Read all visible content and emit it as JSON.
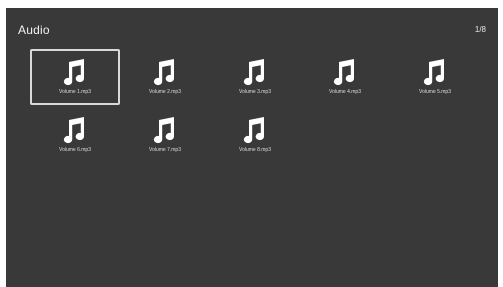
{
  "header": {
    "title": "Audio",
    "page_indicator": "1/8"
  },
  "files": [
    {
      "label": "Volume 1.mp3",
      "icon": "music-note-icon",
      "selected": true
    },
    {
      "label": "Volume 2.mp3",
      "icon": "music-note-icon",
      "selected": false
    },
    {
      "label": "Volume 3.mp3",
      "icon": "music-note-icon",
      "selected": false
    },
    {
      "label": "Volume 4.mp3",
      "icon": "music-note-icon",
      "selected": false
    },
    {
      "label": "Volume 5.mp3",
      "icon": "music-note-icon",
      "selected": false
    },
    {
      "label": "Volume 6.mp3",
      "icon": "music-note-icon",
      "selected": false
    },
    {
      "label": "Volume 7.mp3",
      "icon": "music-note-icon",
      "selected": false
    },
    {
      "label": "Volume 8.mp3",
      "icon": "music-note-icon",
      "selected": false
    }
  ],
  "colors": {
    "background": "#393939",
    "text": "#ffffff",
    "selection_border": "#d9d9d9"
  }
}
